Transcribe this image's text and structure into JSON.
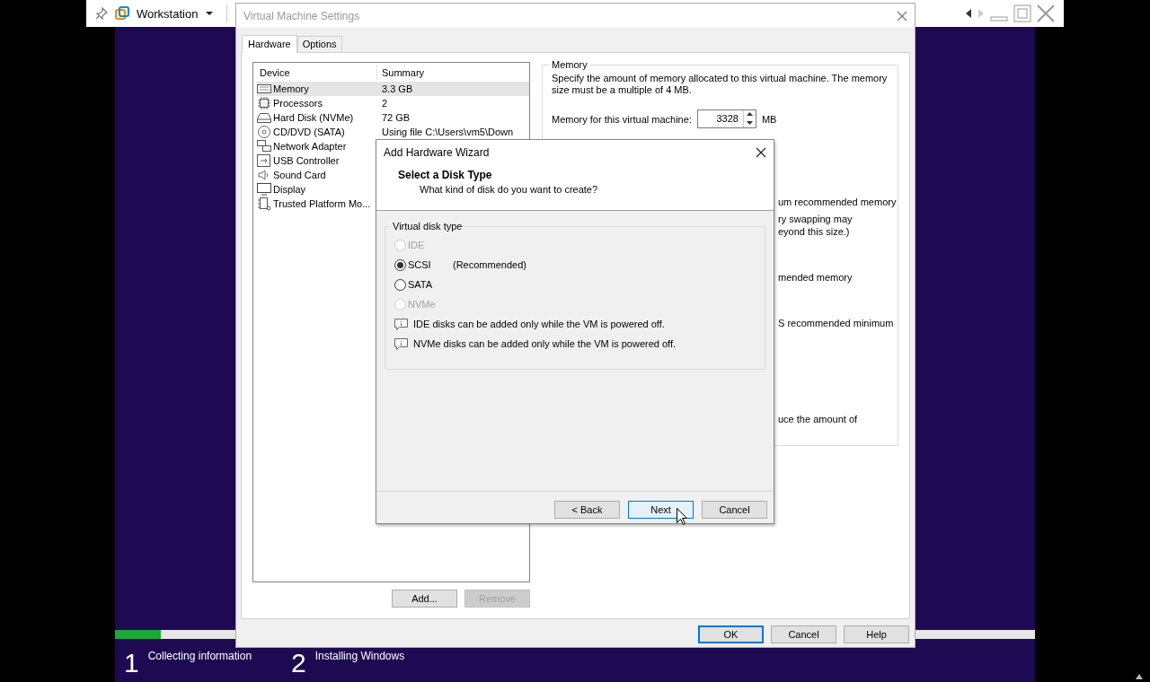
{
  "host_bar": {
    "title": "Workstation"
  },
  "settings_window": {
    "title": "Virtual Machine Settings",
    "tabs": [
      {
        "label": "Hardware",
        "selected": true
      },
      {
        "label": "Options",
        "selected": false
      }
    ],
    "device_table": {
      "columns": [
        "Device",
        "Summary"
      ],
      "rows": [
        {
          "device": "Memory",
          "summary": "3.3 GB",
          "selected": true
        },
        {
          "device": "Processors",
          "summary": "2",
          "selected": false
        },
        {
          "device": "Hard Disk (NVMe)",
          "summary": "72 GB",
          "selected": false
        },
        {
          "device": "CD/DVD (SATA)",
          "summary": "Using file C:\\Users\\vm5\\Down",
          "selected": false
        },
        {
          "device": "Network Adapter",
          "selected": false
        },
        {
          "device": "USB Controller",
          "selected": false
        },
        {
          "device": "Sound Card",
          "selected": false
        },
        {
          "device": "Display",
          "selected": false
        },
        {
          "device": "Trusted Platform Mo...",
          "selected": false
        }
      ]
    },
    "list_buttons": [
      {
        "label": "Add...",
        "disabled": false
      },
      {
        "label": "Remove",
        "disabled": true
      }
    ],
    "memory": {
      "title": "Memory",
      "description": "Specify the amount of memory allocated to this virtual machine. The memory size must be a multiple of 4 MB.",
      "field_label": "Memory for this virtual machine:",
      "value": "3328",
      "unit": "MB",
      "notes": [
        "um recommended memory",
        "ry swapping may",
        "eyond this size.)",
        "mended memory",
        "S recommended minimum",
        "uce the amount of"
      ]
    },
    "buttons": [
      {
        "label": "OK",
        "default": true
      },
      {
        "label": "Cancel",
        "default": false
      },
      {
        "label": "Help",
        "default": false
      }
    ]
  },
  "wizard": {
    "title": "Add Hardware Wizard",
    "heading": "Select a Disk Type",
    "subheading": "What kind of disk do you want to create?",
    "group_title": "Virtual disk type",
    "options": [
      {
        "label": "IDE",
        "selected": false,
        "disabled": true
      },
      {
        "label": "SCSI",
        "note": "(Recommended)",
        "selected": true,
        "disabled": false
      },
      {
        "label": "SATA",
        "selected": false,
        "disabled": false
      },
      {
        "label": "NVMe",
        "selected": false,
        "disabled": true
      }
    ],
    "info": [
      "IDE disks can be added only while the VM is powered off.",
      "NVMe disks can be added only while the VM is powered off."
    ],
    "buttons": [
      {
        "label": "< Back",
        "focused": false
      },
      {
        "label": "Next",
        "focused": true
      },
      {
        "label": "Cancel",
        "focused": false
      }
    ]
  },
  "setup": {
    "level": 0.05,
    "steps": [
      {
        "number": "1",
        "label": "Collecting information"
      },
      {
        "number": "2",
        "label": "Installing Windows"
      }
    ]
  }
}
